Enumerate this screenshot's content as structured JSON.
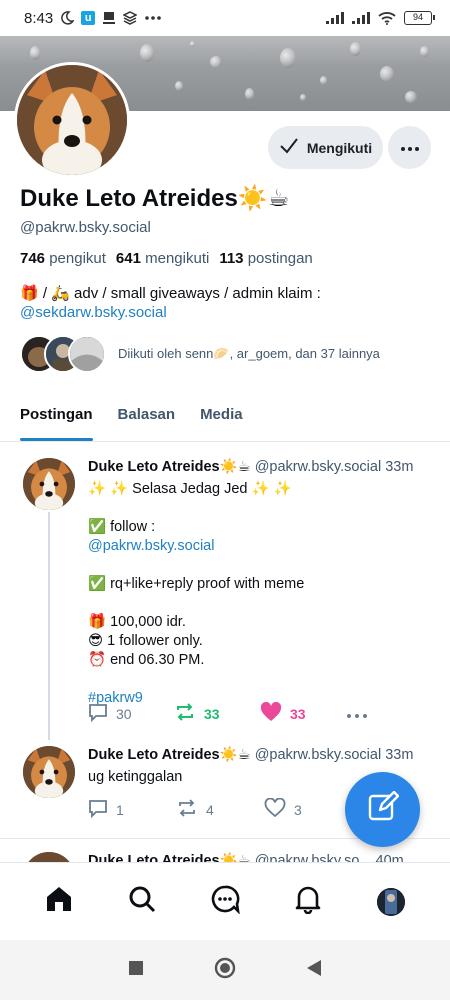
{
  "status_bar": {
    "time": "8:43",
    "battery": "94"
  },
  "profile": {
    "follow_button_label": "Mengikuti",
    "display_name": "Duke Leto Atreides☀️☕",
    "handle": "@pakrw.bsky.social",
    "stats": {
      "followers_count": "746",
      "followers_label": "pengikut",
      "following_count": "641",
      "following_label": "mengikuti",
      "posts_count": "113",
      "posts_label": "postingan"
    },
    "bio_line1": "🎁 / 🛵 adv / small giveaways / admin klaim :",
    "bio_link": "@sekdarw.bsky.social",
    "followed_by": "Diikuti oleh senn🥟, ar_goem, dan 37 lainnya"
  },
  "tabs": [
    {
      "label": "Postingan",
      "active": true
    },
    {
      "label": "Balasan",
      "active": false
    },
    {
      "label": "Media",
      "active": false
    }
  ],
  "posts": [
    {
      "author": "Duke Leto Atreides☀️☕",
      "handle": "@pakrw.bsky.social",
      "time": "33m",
      "lines": {
        "l1": "✨ ✨ Selasa Jedag Jed ✨ ✨",
        "l2": "✅ follow :",
        "l3": "@pakrw.bsky.social",
        "l4": "✅ rq+like+reply proof with meme",
        "l5": "🎁 100,000 idr.",
        "l6": "😎 1 follower only.",
        "l7": "⏰  end 06.30 PM.",
        "l8": "#pakrw9"
      },
      "replies": "30",
      "reposts": "33",
      "likes": "33"
    },
    {
      "author": "Duke Leto Atreides☀️☕",
      "handle": "@pakrw.bsky.social",
      "time": "33m",
      "text": "ug ketinggalan",
      "replies": "1",
      "reposts": "4",
      "likes": "3"
    },
    {
      "author": "Duke Leto Atreides☀️☕",
      "handle": "@pakrw.bsky.so...",
      "time": "40m"
    }
  ],
  "colors": {
    "accent": "#1f80c2",
    "repost_active": "#20bc6f",
    "like_active": "#ec4899",
    "fab": "#2b86e8"
  },
  "icons": [
    "home-icon",
    "search-icon",
    "chat-icon",
    "bell-icon",
    "compose-icon"
  ]
}
